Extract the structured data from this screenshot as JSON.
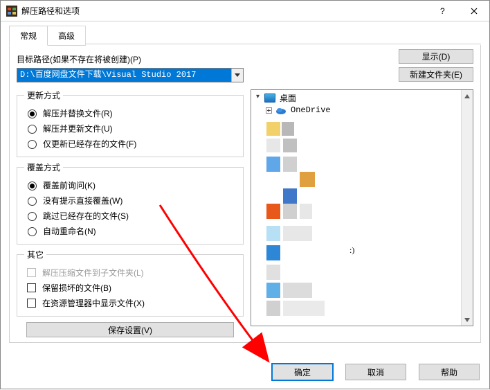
{
  "window": {
    "title": "解压路径和选项"
  },
  "tabs": {
    "general": "常规",
    "advanced": "高级"
  },
  "dest": {
    "label": "目标路径(如果不存在将被创建)(P)",
    "value": "D:\\百度网盘文件下载\\Visual Studio 2017"
  },
  "buttons": {
    "display": "显示(D)",
    "new_folder": "新建文件夹(E)",
    "save_settings": "保存设置(V)",
    "ok": "确定",
    "cancel": "取消",
    "help": "帮助"
  },
  "groups": {
    "update": {
      "legend": "更新方式",
      "opts": {
        "replace": "解压并替换文件(R)",
        "update": "解压并更新文件(U)",
        "fresh": "仅更新已经存在的文件(F)"
      },
      "selected": "replace"
    },
    "overwrite": {
      "legend": "覆盖方式",
      "opts": {
        "ask": "覆盖前询问(K)",
        "silent": "没有提示直接覆盖(W)",
        "skip": "跳过已经存在的文件(S)",
        "autoname": "自动重命名(N)"
      },
      "selected": "ask"
    },
    "other": {
      "legend": "其它",
      "opts": {
        "subfolder": "解压压缩文件到子文件夹(L)",
        "keep_broken": "保留损坏的文件(B)",
        "explorer": "在资源管理器中显示文件(X)"
      }
    }
  },
  "tree": {
    "root": "桌面",
    "node1": "OneDrive",
    "ext_label": ":)"
  }
}
